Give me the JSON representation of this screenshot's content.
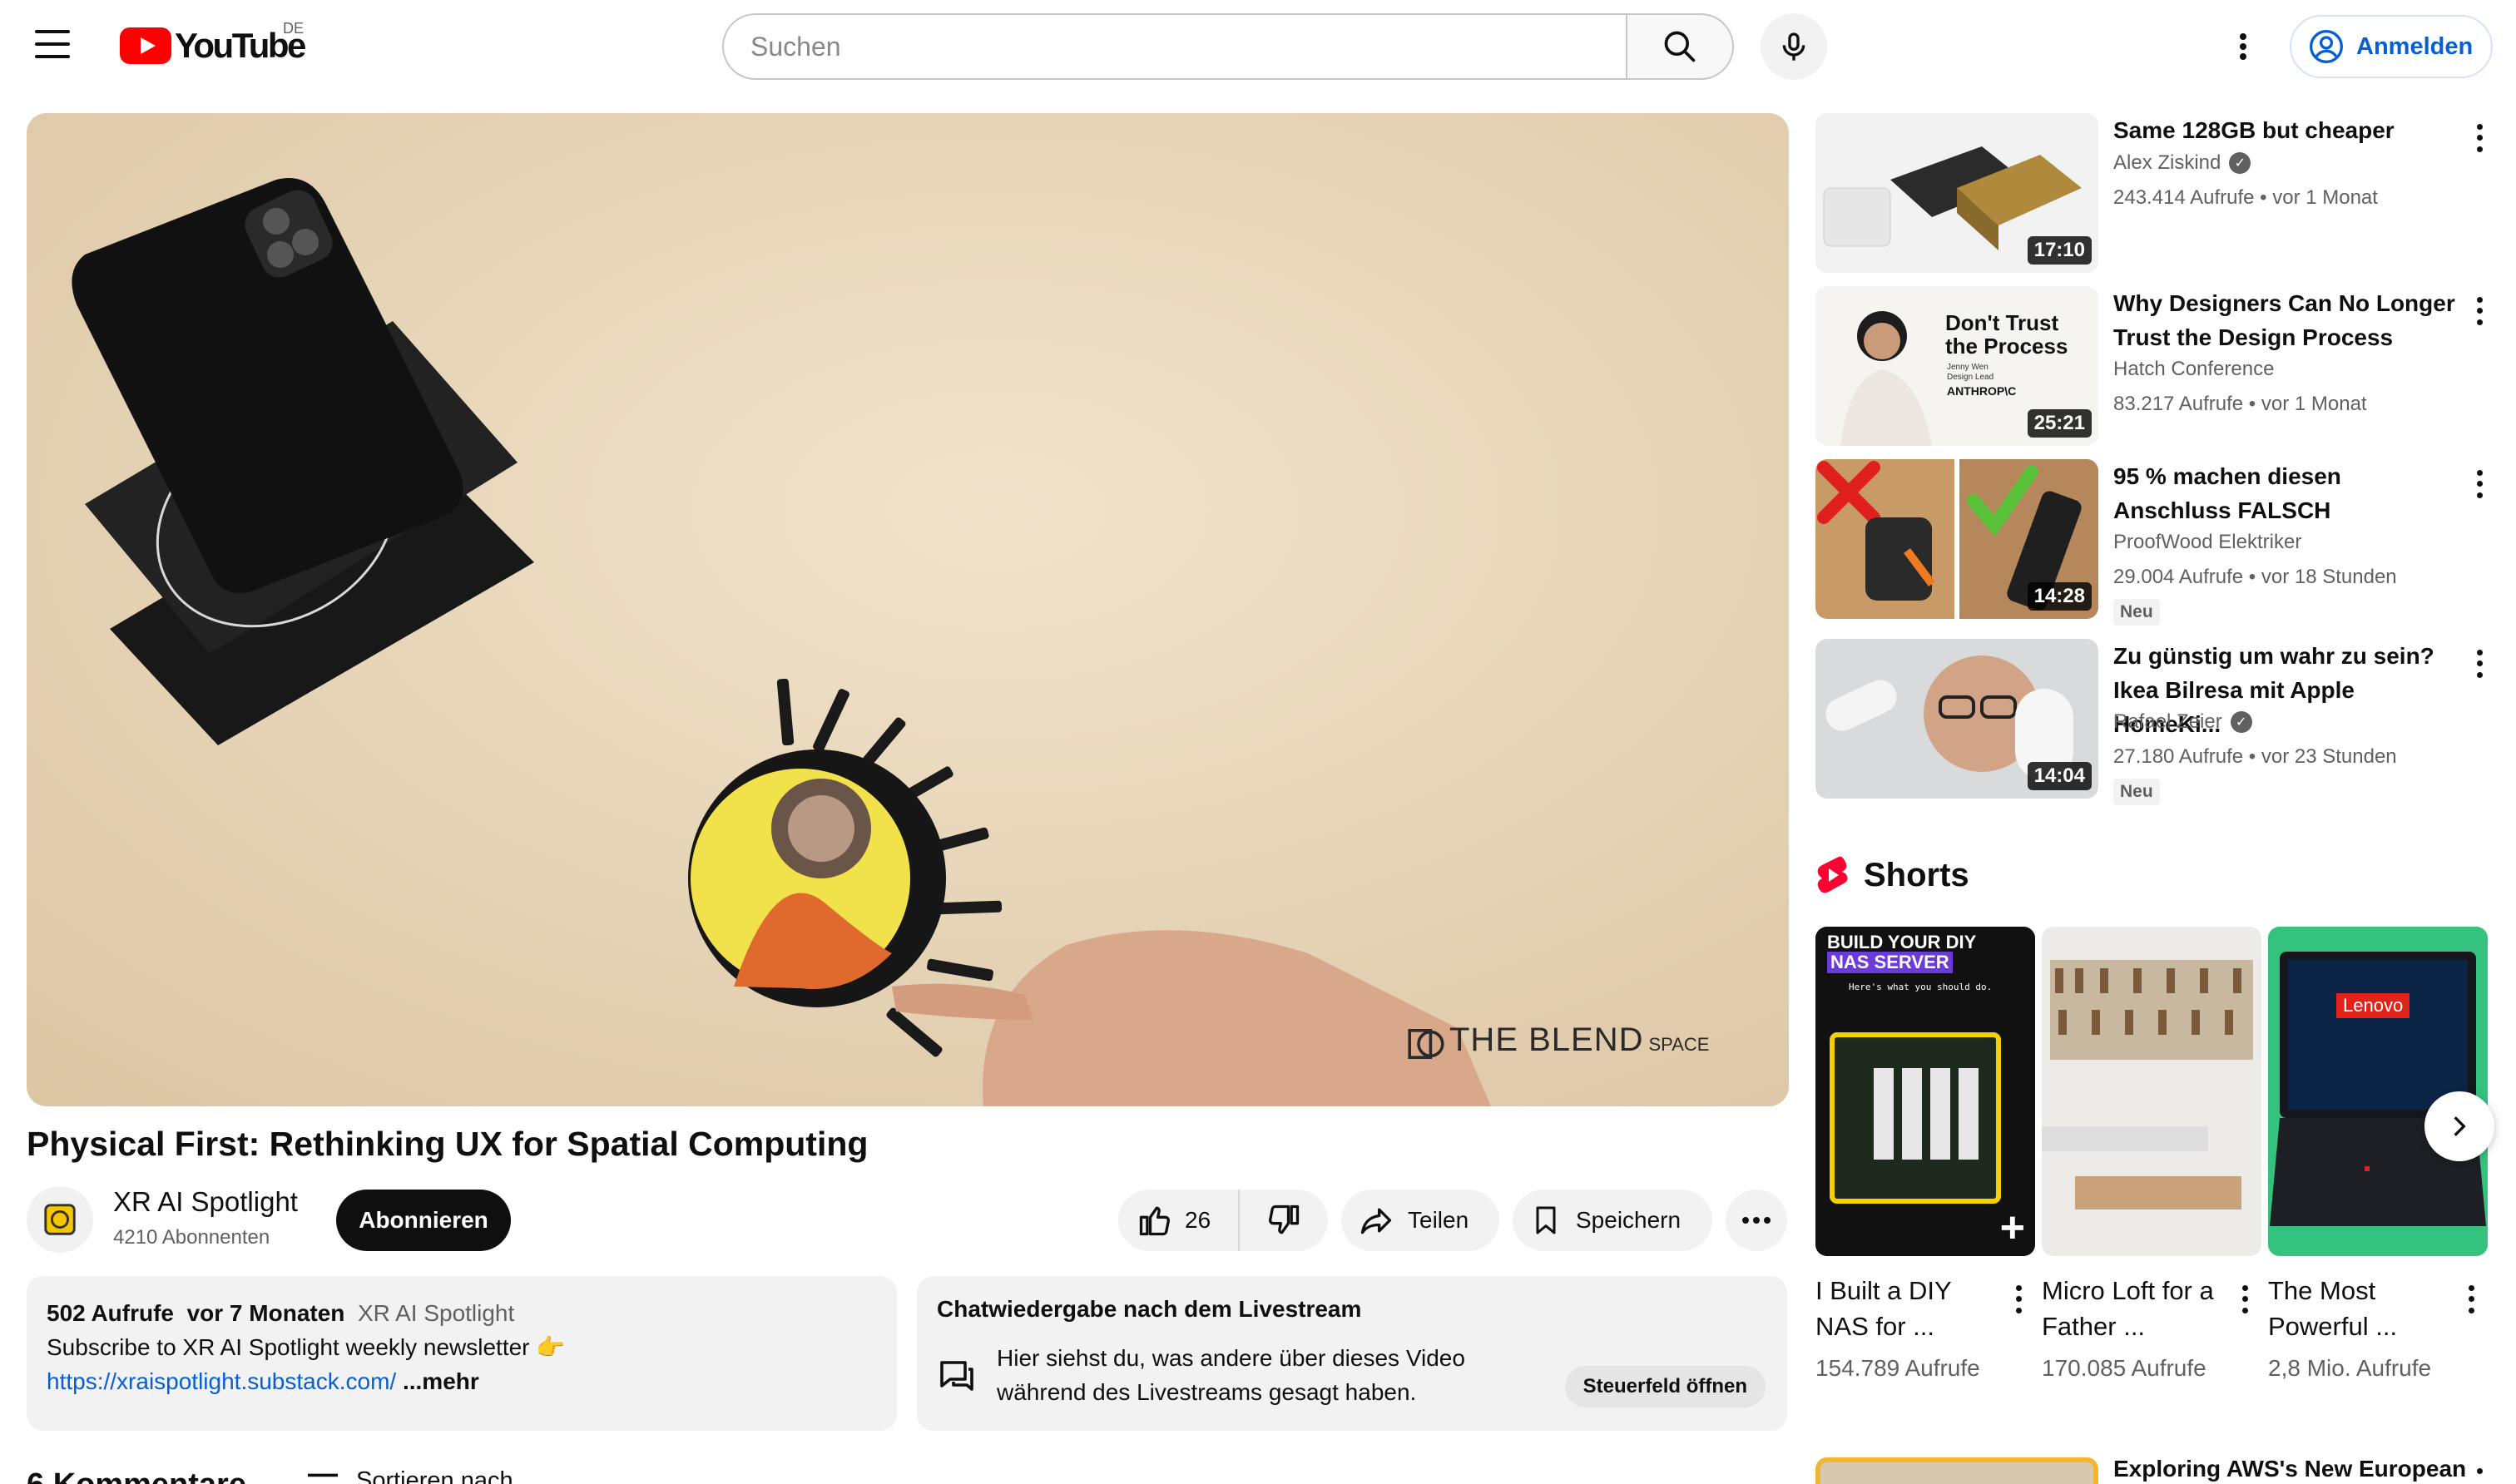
{
  "header": {
    "logo_text": "YouTube",
    "region": "DE",
    "search_placeholder": "Suchen",
    "signin_label": "Anmelden"
  },
  "player": {
    "watermark_main": "THE BLEND",
    "watermark_suffix": "SPACE"
  },
  "video": {
    "title": "Physical First: Rethinking UX for Spatial Computing",
    "channel_name": "XR AI Spotlight",
    "subscribers": "4210 Abonnenten",
    "subscribe_label": "Abonnieren",
    "likes": "26",
    "share_label": "Teilen",
    "save_label": "Speichern"
  },
  "description": {
    "views": "502 Aufrufe",
    "age": "vor 7 Monaten",
    "tag": "XR AI Spotlight",
    "text": "Subscribe to XR AI Spotlight weekly newsletter 👉",
    "link": "https://xraispotlight.substack.com/",
    "more": "...mehr"
  },
  "chat_replay": {
    "title": "Chatwiedergabe nach dem Livestream",
    "text": "Hier siehst du, was andere über dieses Video während des Livestreams gesagt haben.",
    "button": "Steuerfeld öffnen"
  },
  "comments": {
    "title": "6 Kommentare",
    "sort_label": "Sortieren nach"
  },
  "recommendations": [
    {
      "title": "Same 128GB but cheaper",
      "channel": "Alex Ziskind",
      "verified": true,
      "meta": "243.414 Aufrufe • vor 1 Monat",
      "duration": "17:10",
      "badge": ""
    },
    {
      "title": "Why Designers Can No Longer Trust the Design Process",
      "channel": "Hatch Conference",
      "verified": false,
      "meta": "83.217 Aufrufe • vor 1 Monat",
      "duration": "25:21",
      "badge": "",
      "thumb_text": "Don't Trust the Process",
      "thumb_small": "Jenny Wen",
      "thumb_small2": "Design Lead",
      "thumb_brand": "ANTHROP\\C"
    },
    {
      "title": "95 % machen diesen Anschluss FALSCH",
      "channel": "ProofWood Elektriker",
      "verified": false,
      "meta": "29.004 Aufrufe • vor 18 Stunden",
      "duration": "14:28",
      "badge": "Neu"
    },
    {
      "title": "Zu günstig um wahr zu sein? Ikea Bilresa mit Apple HomeKi...",
      "channel": "Rafael Zeier",
      "verified": true,
      "meta": "27.180 Aufrufe • vor 23 Stunden",
      "duration": "14:04",
      "badge": "Neu"
    }
  ],
  "shorts": {
    "label": "Shorts",
    "items": [
      {
        "title": "I Built a DIY NAS for ...",
        "views": "154.789 Aufrufe",
        "thumb_line1": "BUILD YOUR DIY",
        "thumb_line2": "NAS SERVER",
        "thumb_line3": "Here's what you should do."
      },
      {
        "title": "Micro Loft for a Father ...",
        "views": "170.085 Aufrufe"
      },
      {
        "title": "The Most Powerful ...",
        "views": "2,8 Mio. Aufrufe",
        "thumb_brand": "Lenovo"
      }
    ]
  },
  "last_recommendation": {
    "title": "Exploring AWS's New European"
  },
  "colors": {
    "brand_red": "#ff0000",
    "link_blue": "#065fd4",
    "shorts_green": "#35c27e"
  }
}
